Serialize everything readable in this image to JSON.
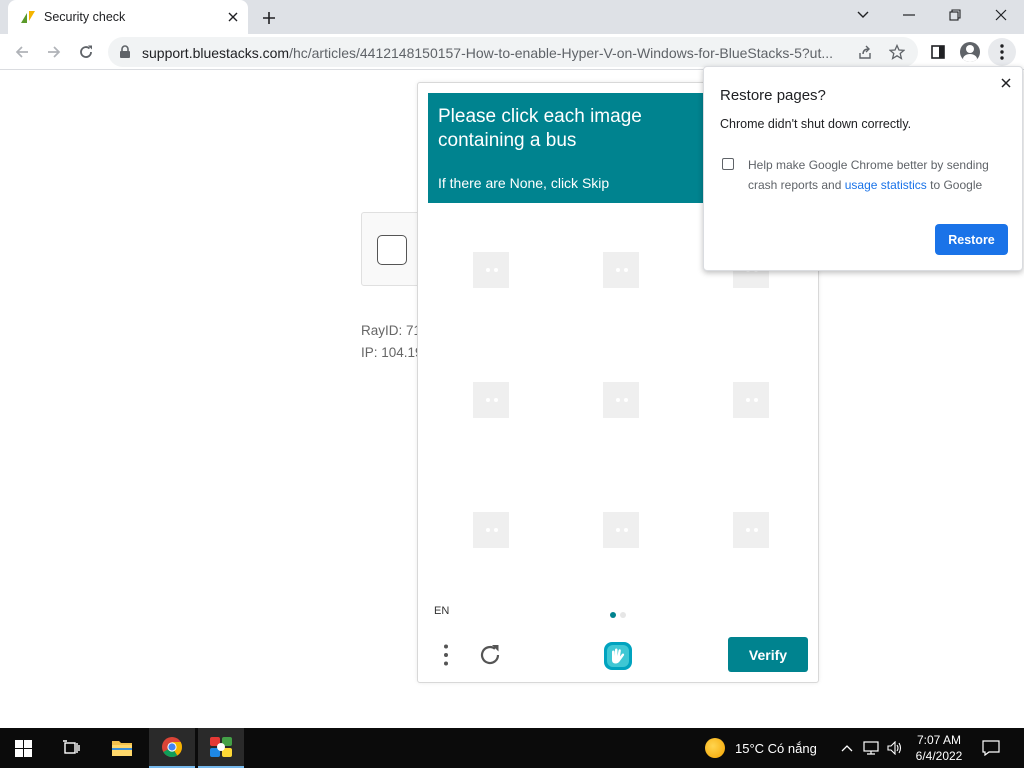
{
  "browser": {
    "tab": {
      "title": "Security check",
      "favicon": "zendesk-favicon"
    },
    "url": {
      "host": "support.bluestacks.com",
      "path": "/hc/articles/4412148150157-How-to-enable-Hyper-V-on-Windows-for-BlueStacks-5?ut..."
    }
  },
  "page": {
    "ray_id": "RayID: 71",
    "ip": "IP: 104.19"
  },
  "captcha": {
    "prompt_line1": "Please click each image",
    "prompt_line2": "containing a bus",
    "prompt_sub": "If there are None, click Skip",
    "language": "EN",
    "verify_label": "Verify",
    "accent": "#00838f",
    "tiles": [
      {
        "id": 1,
        "selected": false
      },
      {
        "id": 2,
        "selected": false
      },
      {
        "id": 3,
        "selected": false
      },
      {
        "id": 4,
        "selected": false
      },
      {
        "id": 5,
        "selected": false
      },
      {
        "id": 6,
        "selected": false
      },
      {
        "id": 7,
        "selected": false
      },
      {
        "id": 8,
        "selected": false
      },
      {
        "id": 9,
        "selected": false
      }
    ]
  },
  "restore_popup": {
    "title": "Restore pages?",
    "message": "Chrome didn't shut down correctly.",
    "help_text_1": "Help make Google Chrome better by sending crash reports and",
    "help_link": "usage statistics",
    "help_text_2": "to Google",
    "help_checked": false,
    "button_label": "Restore",
    "button_color": "#1a73e8"
  },
  "taskbar": {
    "weather": "15°C  Có nắng",
    "time": "7:07 AM",
    "date": "6/4/2022"
  }
}
